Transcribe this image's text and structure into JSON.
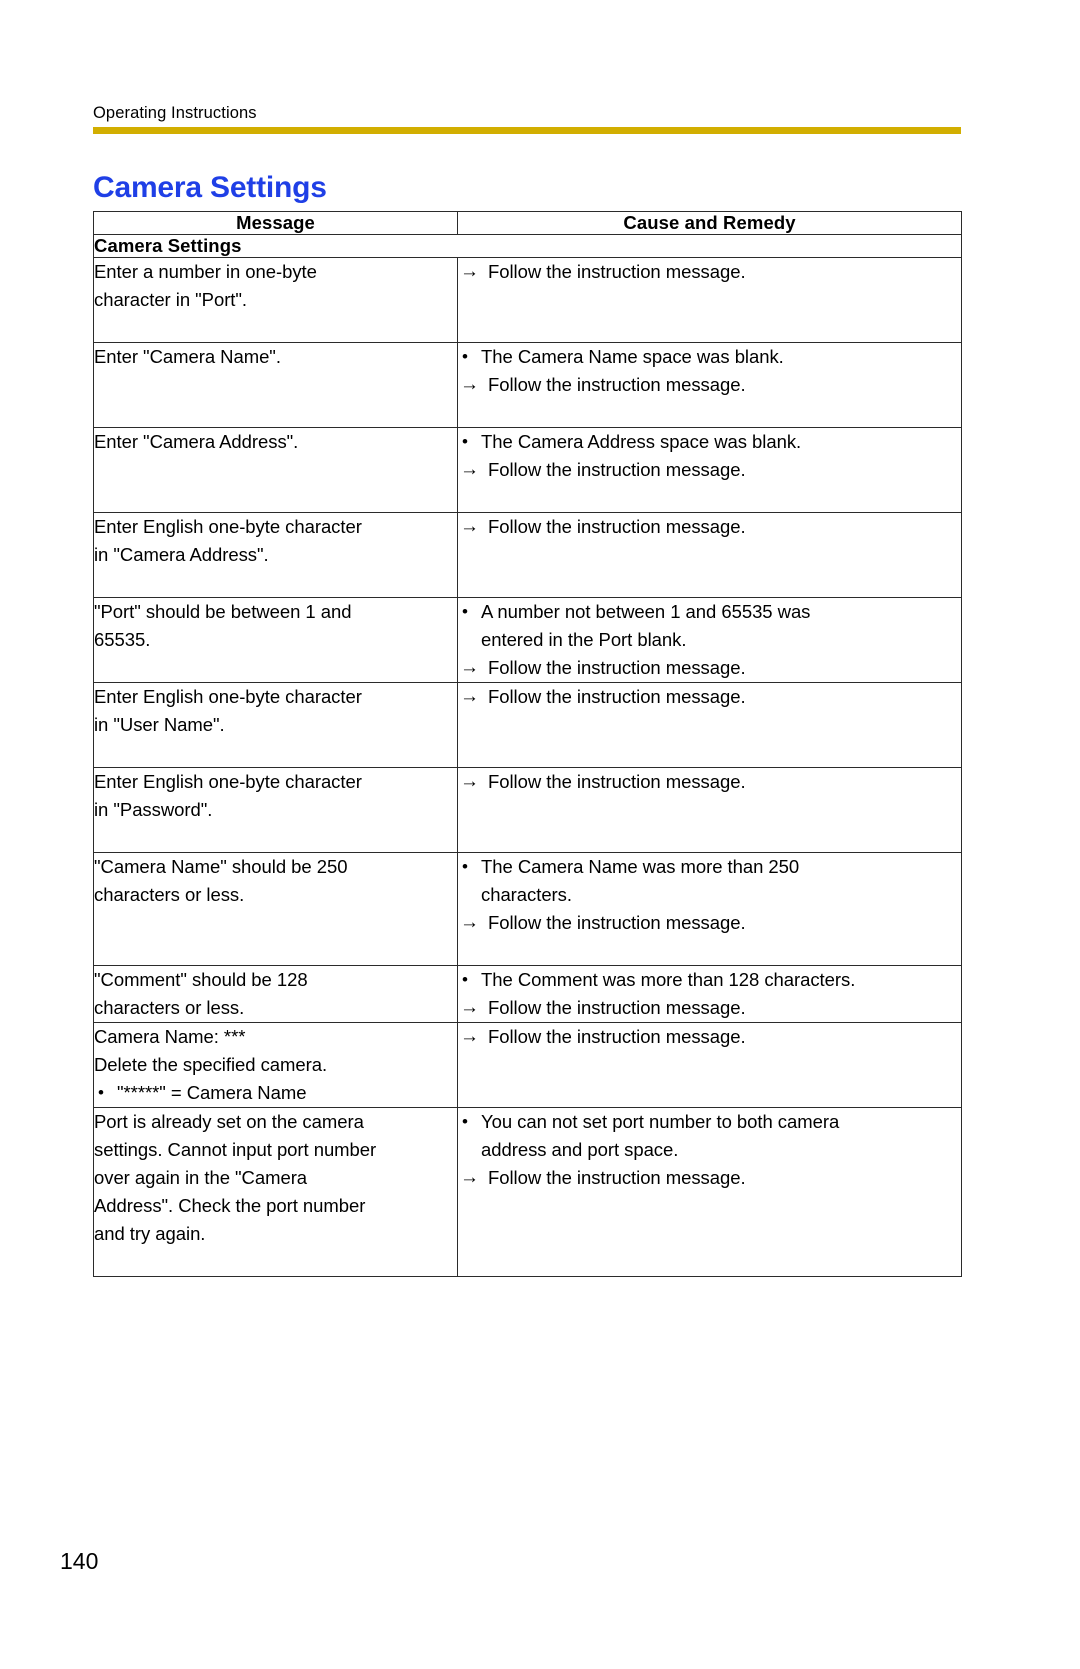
{
  "header": {
    "running_head": "Operating Instructions",
    "rule_color": "#D2AE00"
  },
  "title": {
    "text": "Camera Settings",
    "color": "#1F3FE6"
  },
  "table": {
    "columns": [
      "Message",
      "Cause and Remedy"
    ],
    "section_label": "Camera Settings",
    "rows": [
      {
        "message": [
          "Enter a number in one-byte",
          "character in \"Port\"."
        ],
        "causes": [],
        "remedies": [
          "Follow the instruction message."
        ]
      },
      {
        "message": [
          "Enter \"Camera Name\"."
        ],
        "causes": [
          "The Camera Name space was blank."
        ],
        "remedies": [
          "Follow the instruction message."
        ]
      },
      {
        "message": [
          "Enter \"Camera Address\"."
        ],
        "causes": [
          "The Camera Address space was blank."
        ],
        "remedies": [
          "Follow the instruction message."
        ]
      },
      {
        "message": [
          "Enter English one-byte character",
          "in \"Camera Address\"."
        ],
        "causes": [],
        "remedies": [
          "Follow the instruction message."
        ]
      },
      {
        "message": [
          "\"Port\" should be between 1 and",
          "65535."
        ],
        "causes": [
          "A number not between 1 and 65535 was",
          "entered in the Port blank."
        ],
        "remedies": [
          "Follow the instruction message."
        ]
      },
      {
        "message": [
          "Enter English one-byte character",
          "in \"User Name\"."
        ],
        "causes": [],
        "remedies": [
          "Follow the instruction message."
        ]
      },
      {
        "message": [
          "Enter English one-byte character",
          "in \"Password\"."
        ],
        "causes": [],
        "remedies": [
          "Follow the instruction message."
        ]
      },
      {
        "message": [
          "\"Camera Name\" should be 250",
          "characters or less."
        ],
        "causes": [
          "The Camera Name was more than 250",
          "characters."
        ],
        "remedies": [
          "Follow the instruction message."
        ]
      },
      {
        "message": [
          "\"Comment\" should be 128",
          "characters or less."
        ],
        "causes": [
          "The Comment was more than 128 characters."
        ],
        "remedies": [
          "Follow the instruction message."
        ]
      },
      {
        "message": [
          "Camera Name: ***",
          "Delete the specified camera."
        ],
        "message_bullets": [
          "\"*****\" = Camera Name"
        ],
        "causes": [],
        "remedies": [
          "Follow the instruction message."
        ]
      },
      {
        "message": [
          "Port is already set on the camera",
          "settings. Cannot input port number",
          "over again in the \"Camera",
          "Address\". Check the port number",
          "and try again."
        ],
        "causes": [
          "You can not set port number to both camera",
          "address and port space."
        ],
        "remedies": [
          "Follow the instruction message."
        ]
      }
    ]
  },
  "footer": {
    "page_number": "140"
  }
}
